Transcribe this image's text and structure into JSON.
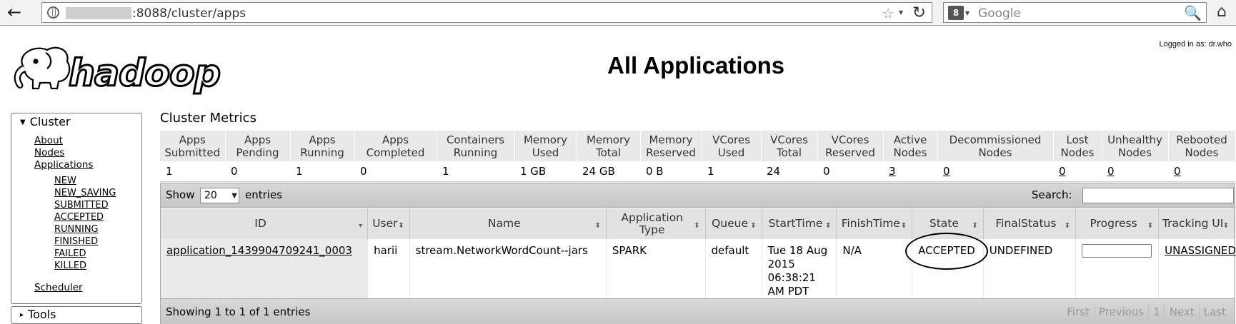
{
  "browser": {
    "url": ":8088/cluster/apps",
    "search_placeholder": "Google",
    "engine_icon": "google-engine-icon"
  },
  "header": {
    "logged_in": "Logged in as: dr.who",
    "title": "All Applications",
    "logo_text": "hadoop"
  },
  "nav": {
    "cluster_label": "Cluster",
    "links": [
      "About",
      "Nodes",
      "Applications"
    ],
    "states": [
      "NEW",
      "NEW_SAVING",
      "SUBMITTED",
      "ACCEPTED",
      "RUNNING",
      "FINISHED",
      "FAILED",
      "KILLED"
    ],
    "scheduler": "Scheduler",
    "tools_label": "Tools"
  },
  "metrics": {
    "title": "Cluster Metrics",
    "headers": [
      [
        "Apps",
        "Submitted"
      ],
      [
        "Apps",
        "Pending"
      ],
      [
        "Apps",
        "Running"
      ],
      [
        "Apps",
        "Completed"
      ],
      [
        "Containers",
        "Running"
      ],
      [
        "Memory",
        "Used"
      ],
      [
        "Memory",
        "Total"
      ],
      [
        "Memory",
        "Reserved"
      ],
      [
        "VCores",
        "Used"
      ],
      [
        "VCores",
        "Total"
      ],
      [
        "VCores",
        "Reserved"
      ],
      [
        "Active",
        "Nodes"
      ],
      [
        "Decommissioned",
        "Nodes"
      ],
      [
        "Lost",
        "Nodes"
      ],
      [
        "Unhealthy",
        "Nodes"
      ],
      [
        "Rebooted",
        "Nodes"
      ]
    ],
    "values": [
      "1",
      "0",
      "1",
      "0",
      "1",
      "1 GB",
      "24 GB",
      "0 B",
      "1",
      "24",
      "0",
      "3",
      "0",
      "0",
      "0",
      "0"
    ]
  },
  "apps": {
    "show_label": "Show",
    "page_length": "20",
    "entries_label": "entries",
    "search_label": "Search:",
    "columns": [
      [
        "ID",
        ""
      ],
      [
        "User",
        ""
      ],
      [
        "Name",
        ""
      ],
      [
        "Application",
        "Type"
      ],
      [
        "Queue",
        ""
      ],
      [
        "StartTime",
        ""
      ],
      [
        "FinishTime",
        ""
      ],
      [
        "State",
        ""
      ],
      [
        "FinalStatus",
        ""
      ],
      [
        "Progress",
        ""
      ],
      [
        "Tracking UI",
        ""
      ]
    ],
    "rows": [
      {
        "id": "application_1439904709241_0003",
        "user": "harii",
        "name": "stream.NetworkWordCount--jars",
        "type": "SPARK",
        "queue": "default",
        "start_lines": [
          "Tue 18 Aug",
          "2015",
          "06:38:21",
          "AM PDT"
        ],
        "finish": "N/A",
        "state": "ACCEPTED",
        "final_status": "UNDEFINED",
        "progress": 0,
        "tracking": "UNASSIGNED"
      }
    ],
    "showing": "Showing 1 to 1 of 1 entries",
    "pager": [
      "First",
      "Previous",
      "1",
      "Next",
      "Last"
    ]
  }
}
